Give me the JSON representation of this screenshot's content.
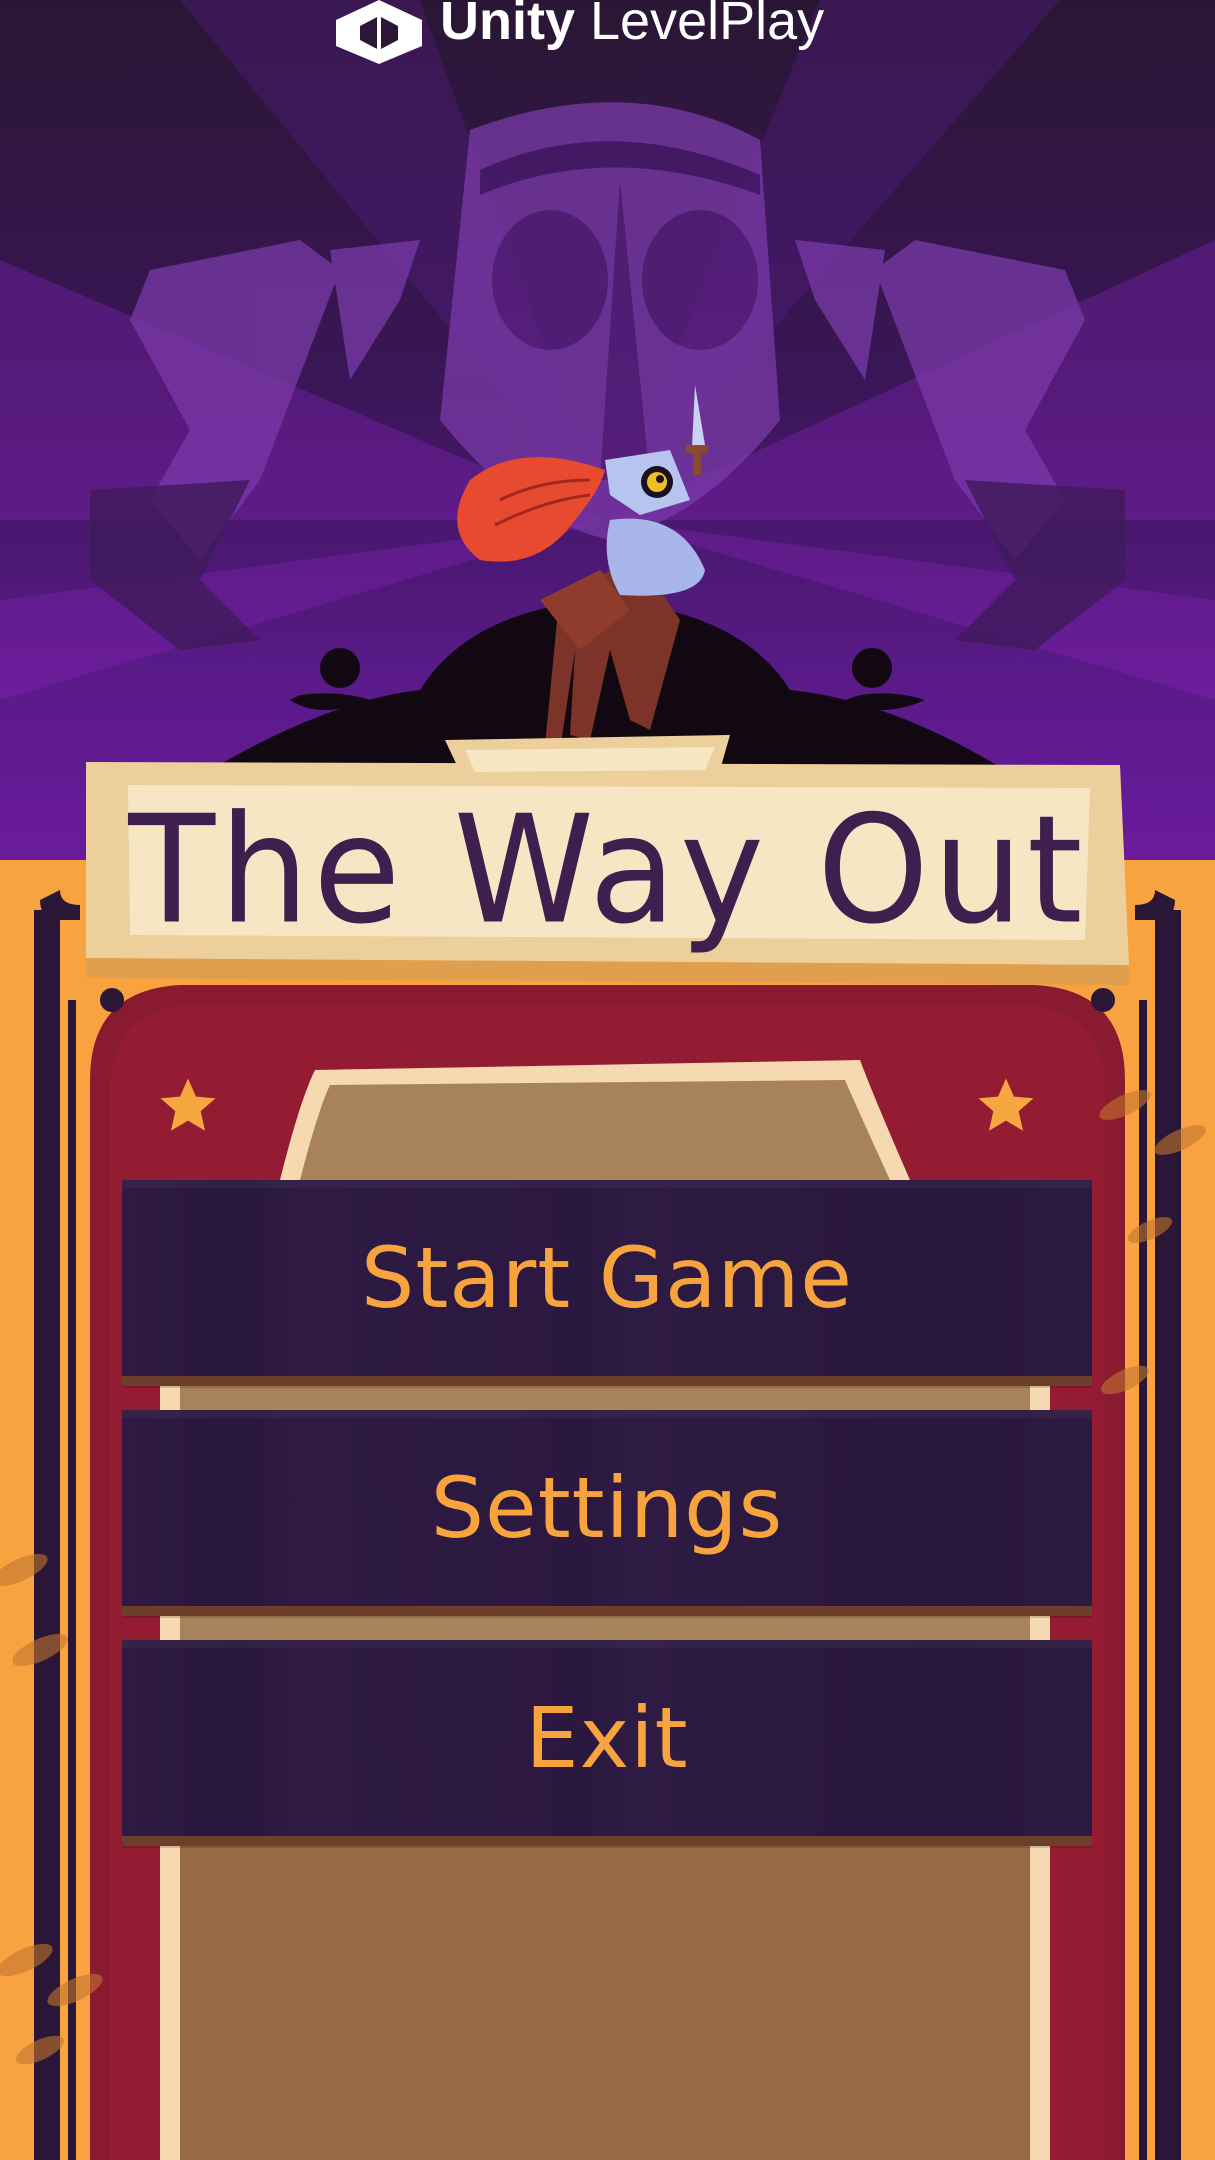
{
  "brand": {
    "name_bold": "Unity",
    "name_light": " LevelPlay",
    "icon": "unity-cube-icon"
  },
  "game": {
    "title": "The Way Out"
  },
  "menu": {
    "start_label": "Start Game",
    "settings_label": "Settings",
    "exit_label": "Exit"
  },
  "colors": {
    "purple_bg": "#7c1cb0",
    "orange_frame": "#f8a33f",
    "red_panel": "#8a1a30",
    "button_bg": "#2e1a42",
    "button_text": "#f7a43e",
    "title_text": "#3f1f4e",
    "parchment": "#f3e2bb"
  }
}
